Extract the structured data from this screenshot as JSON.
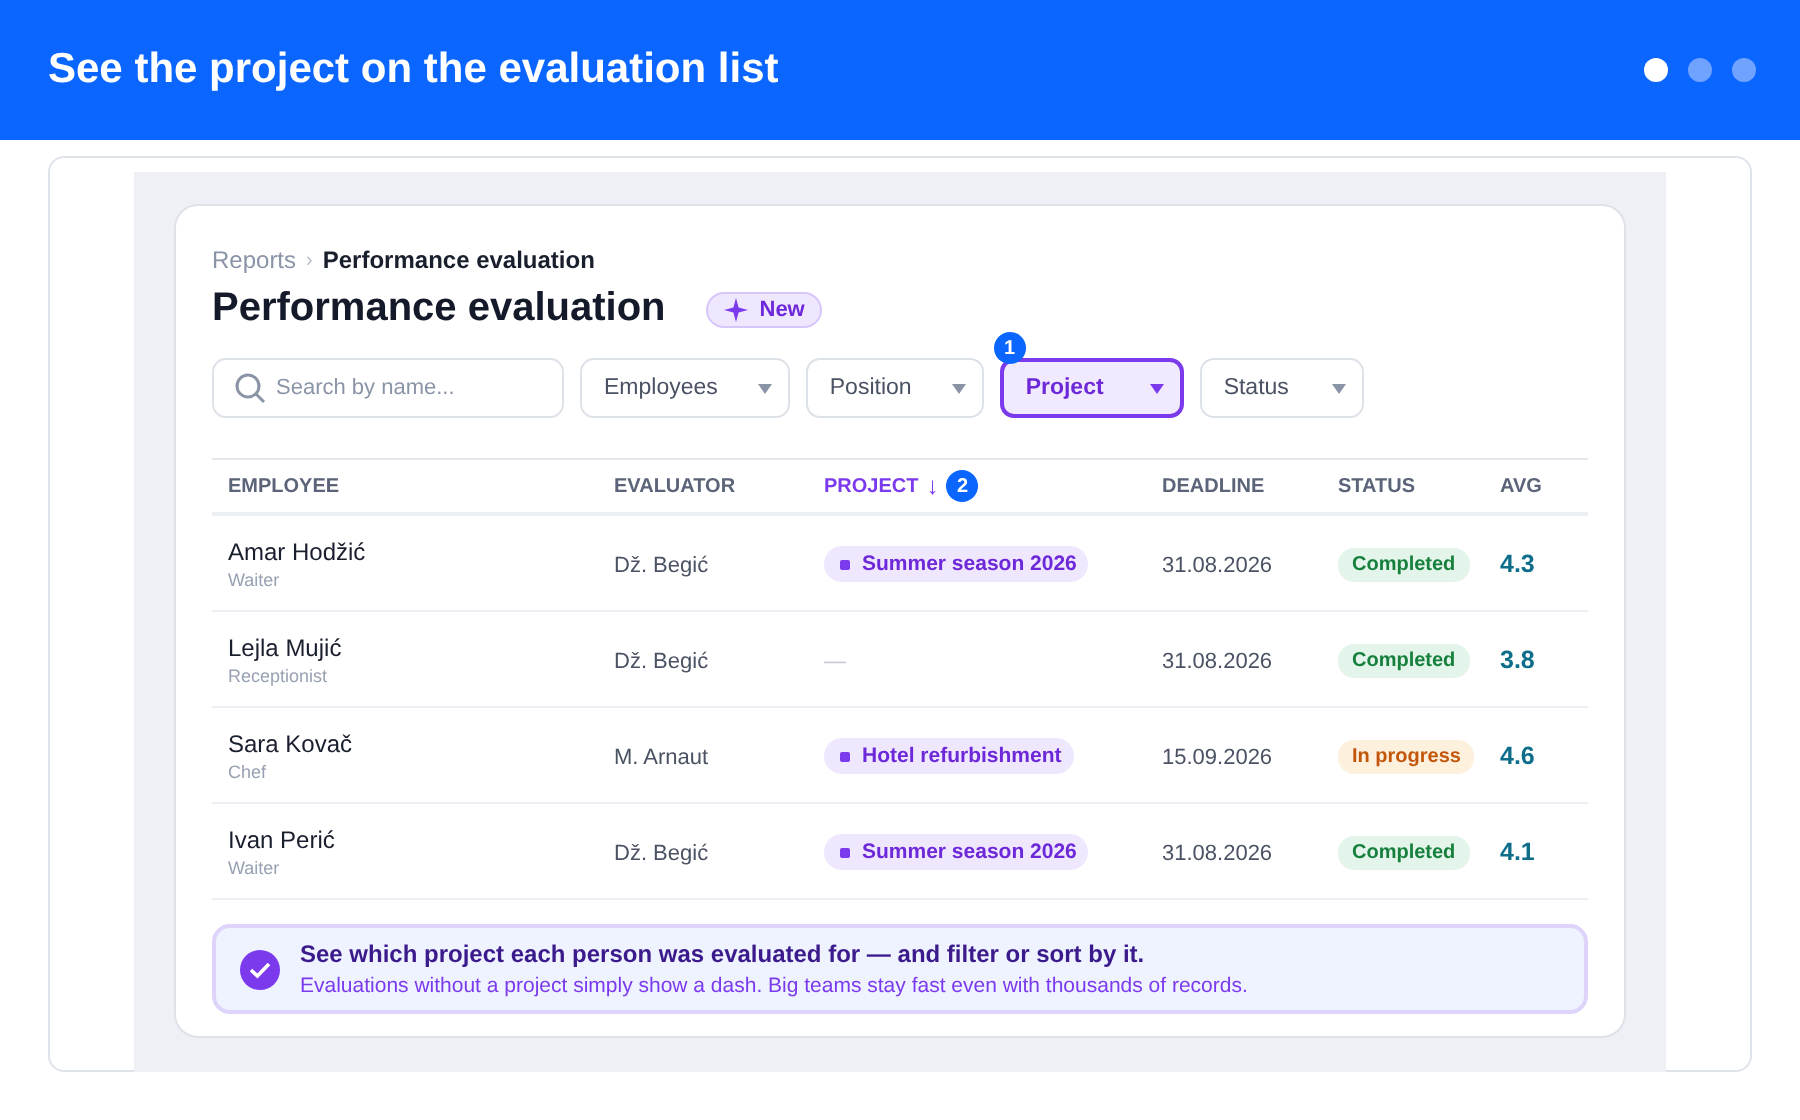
{
  "header": {
    "title": "See the project on the evaluation list",
    "pager": [
      {
        "selected": true
      },
      {
        "selected": false
      },
      {
        "selected": false
      }
    ]
  },
  "breadcrumb": {
    "parent": "Reports",
    "separator": "›",
    "current": "Performance evaluation"
  },
  "page_title": "Performance evaluation",
  "new_badge": {
    "label": "New"
  },
  "search": {
    "placeholder": "Search by name..."
  },
  "filters": [
    {
      "label": "Employees",
      "selected": false
    },
    {
      "label": "Position",
      "selected": false
    },
    {
      "label": "Project",
      "selected": true,
      "step": "1"
    },
    {
      "label": "Status",
      "selected": false
    }
  ],
  "table": {
    "columns": [
      {
        "label": "EMPLOYEE",
        "sorted": false
      },
      {
        "label": "EVALUATOR",
        "sorted": false
      },
      {
        "label": "PROJECT",
        "sorted": true,
        "sort_arrow": "↓",
        "step": "2"
      },
      {
        "label": "DEADLINE",
        "sorted": false
      },
      {
        "label": "STATUS",
        "sorted": false
      },
      {
        "label": "AVG",
        "sorted": false
      }
    ],
    "rows": [
      {
        "name": "Amar Hodžić",
        "position": "Waiter",
        "evaluator": "Dž. Begić",
        "project": {
          "kind": "tag",
          "label": "Summer season 2026"
        },
        "deadline": "31.08.2026",
        "status": {
          "kind": "done",
          "label": "Completed"
        },
        "avg": "4.3"
      },
      {
        "name": "Lejla Mujić",
        "position": "Receptionist",
        "evaluator": "Dž. Begić",
        "project": {
          "kind": "dash",
          "label": "—"
        },
        "deadline": "31.08.2026",
        "status": {
          "kind": "done",
          "label": "Completed"
        },
        "avg": "3.8"
      },
      {
        "name": "Sara Kovač",
        "position": "Chef",
        "evaluator": "M. Arnaut",
        "project": {
          "kind": "tag",
          "label": "Hotel refurbishment"
        },
        "deadline": "15.09.2026",
        "status": {
          "kind": "progress",
          "label": "In progress"
        },
        "avg": "4.6"
      },
      {
        "name": "Ivan Perić",
        "position": "Waiter",
        "evaluator": "Dž. Begić",
        "project": {
          "kind": "tag",
          "label": "Summer season 2026"
        },
        "deadline": "31.08.2026",
        "status": {
          "kind": "done",
          "label": "Completed"
        },
        "avg": "4.1"
      }
    ]
  },
  "callout": {
    "title": "See which project each person was evaluated for — and filter or sort by it.",
    "text": "Evaluations without a project simply show a dash. Big teams stay fast even with thousands of records."
  }
}
